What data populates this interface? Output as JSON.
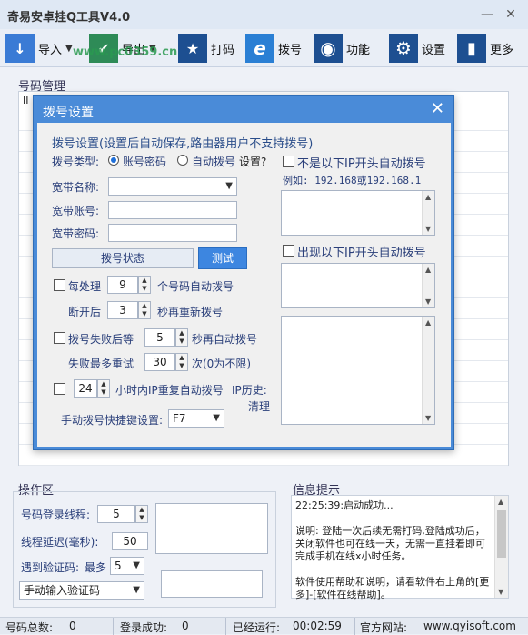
{
  "window": {
    "title": "奇易安卓挂Q工具V4.0",
    "min_glyph": "—",
    "close_glyph": "✕"
  },
  "watermark": "www.pc0359.cn",
  "toolbar": {
    "items": [
      {
        "label": "导入",
        "icon": "import-icon",
        "color": "#3a7bd5",
        "glyph": "↓"
      },
      {
        "label": "导出",
        "icon": "export-icon",
        "color": "#2e8b57",
        "glyph": "✔"
      },
      {
        "label": "打码",
        "icon": "star-icon",
        "color": "#1d4f91",
        "glyph": "★"
      },
      {
        "label": "拨号",
        "icon": "ie-icon",
        "color": "#2a7fd4",
        "glyph": "e"
      },
      {
        "label": "功能",
        "icon": "disc-icon",
        "color": "#1d4f91",
        "glyph": "◉"
      },
      {
        "label": "设置",
        "icon": "settings-icon",
        "color": "#1d4f91",
        "glyph": "⚙"
      },
      {
        "label": "更多",
        "icon": "chart-icon",
        "color": "#1d4f91",
        "glyph": "▮"
      }
    ],
    "caret": "▼"
  },
  "number_mgmt": {
    "title": "号码管理",
    "header_stub": "II"
  },
  "dialog": {
    "title": "拨号设置",
    "close_glyph": "✕",
    "group_title": "拨号设置(设置后自动保存,路由器用户不支持拨号)",
    "dial_type_label": "拨号类型:",
    "radio_account": "账号密码",
    "radio_auto": "自动拨号",
    "setting_link": "设置?",
    "broadband_name_label": "宽带名称:",
    "broadband_account_label": "宽带账号:",
    "broadband_password_label": "宽带密码:",
    "status_button": "拨号状态",
    "test_button": "测试",
    "process_every_label": "每处理",
    "process_every_value": "9",
    "process_every_suffix": "个号码自动拨号",
    "disconnect_after_label": "断开后",
    "disconnect_after_value": "3",
    "disconnect_after_suffix": "秒再重新拨号",
    "fail_wait_label": "拨号失败后等",
    "fail_wait_value": "5",
    "fail_wait_suffix": "秒再自动拨号",
    "max_retry_label": "失败最多重试",
    "max_retry_value": "30",
    "max_retry_suffix": "次(0为不限)",
    "hours_value": "24",
    "hours_suffix": "小时内IP重复自动拨号",
    "ip_history_label": "IP历史:",
    "clear_link": "清理",
    "hotkey_label": "手动拨号快捷键设置:",
    "hotkey_value": "F7",
    "not_ip_label": "不是以下IP开头自动拨号",
    "example_label": "例如: 192.168或192.168.1",
    "appear_ip_label": "出现以下IP开头自动拨号",
    "arrow_up": "▲",
    "arrow_down": "▼"
  },
  "operation": {
    "title": "操作区",
    "login_threads_label": "号码登录线程:",
    "login_threads_value": "5",
    "thread_delay_label": "线程延迟(毫秒):",
    "thread_delay_value": "50",
    "captcha_label": "遇到验证码:",
    "max_label": "最多",
    "max_value": "5",
    "captcha_mode": "手动输入验证码"
  },
  "info": {
    "title": "信息提示",
    "text": "22:25:39:启动成功...\n\n说明: 登陆一次后续无需打码,登陆成功后，关闭软件也可在线一天，无需一直挂着即可完成手机在线x小时任务。\n\n软件使用帮助和说明，请看软件右上角的[更多]-[软件在线帮助]。"
  },
  "status": {
    "total_label": "号码总数:",
    "total_value": "0",
    "success_label": "登录成功:",
    "success_value": "0",
    "running_label": "已经运行:",
    "running_value": "00:02:59",
    "site_label": "官方网站:",
    "site_value": "www.qyisoft.com"
  }
}
